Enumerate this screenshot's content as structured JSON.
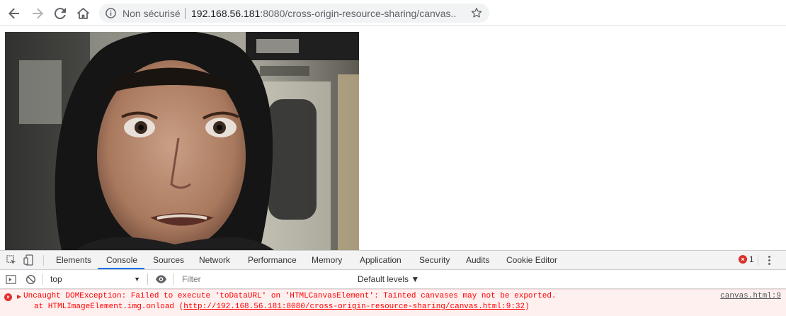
{
  "browser": {
    "security_label": "Non sécurisé",
    "url_host": "192.168.56.181",
    "url_rest": ":8080/cross-origin-resource-sharing/canvas...."
  },
  "devtools": {
    "tabs": [
      "Elements",
      "Console",
      "Sources",
      "Network",
      "Performance",
      "Memory",
      "Application",
      "Security",
      "Audits",
      "Cookie Editor"
    ],
    "active_tab": "Console",
    "error_count": "1",
    "context": "top",
    "filter_placeholder": "Filter",
    "levels_label": "Default levels ▼"
  },
  "console": {
    "error_message": "Uncaught DOMException: Failed to execute 'toDataURL' on 'HTMLCanvasElement': Tainted canvases may not be exported.",
    "stack_prefix": "at HTMLImageElement.img.onload (",
    "stack_link": "http://192.168.56.181:8080/cross-origin-resource-sharing/canvas.html:9:32",
    "stack_suffix": ")",
    "source": "canvas.html:9"
  },
  "colors": {
    "error_red": "#ff0000",
    "active_tab_accent": "#1a73e8"
  }
}
